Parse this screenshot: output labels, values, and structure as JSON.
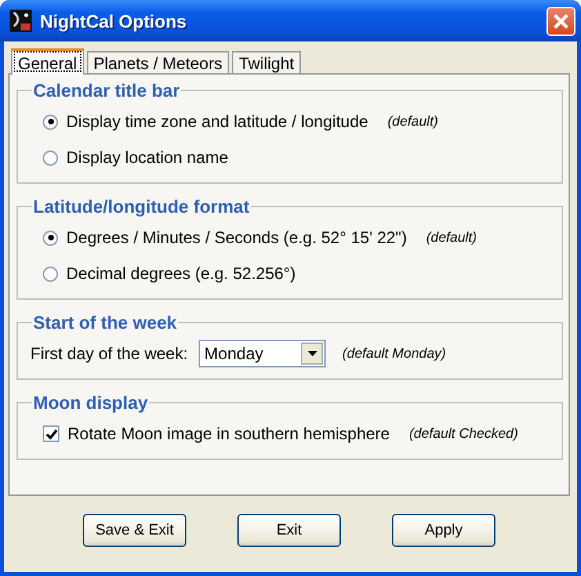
{
  "window": {
    "title": "NightCal Options"
  },
  "tabs": [
    {
      "label": "General",
      "selected": true
    },
    {
      "label": "Planets / Meteors",
      "selected": false
    },
    {
      "label": "Twilight",
      "selected": false
    }
  ],
  "groups": [
    {
      "title": "Calendar title bar",
      "options": [
        {
          "kind": "radio",
          "label": "Display time zone and latitude / longitude",
          "note": "(default)",
          "selected": true
        },
        {
          "kind": "radio",
          "label": "Display location name",
          "selected": false
        }
      ]
    },
    {
      "title": "Latitude/longitude format",
      "options": [
        {
          "kind": "radio",
          "label": "Degrees / Minutes / Seconds  (e.g. 52° 15' 22\")",
          "note": "(default)",
          "selected": true
        },
        {
          "kind": "radio",
          "label": "Decimal degrees  (e.g. 52.256°)",
          "selected": false
        }
      ]
    },
    {
      "title": "Start of the week",
      "options": [
        {
          "kind": "dropdown",
          "label": "First day of the week:",
          "value": "Monday",
          "note": "(default Monday)"
        }
      ]
    },
    {
      "title": "Moon display",
      "options": [
        {
          "kind": "checkbox",
          "label": "Rotate Moon image in southern hemisphere",
          "note": "(default Checked)",
          "checked": true
        }
      ]
    }
  ],
  "buttons": [
    "Save & Exit",
    "Exit",
    "Apply"
  ]
}
